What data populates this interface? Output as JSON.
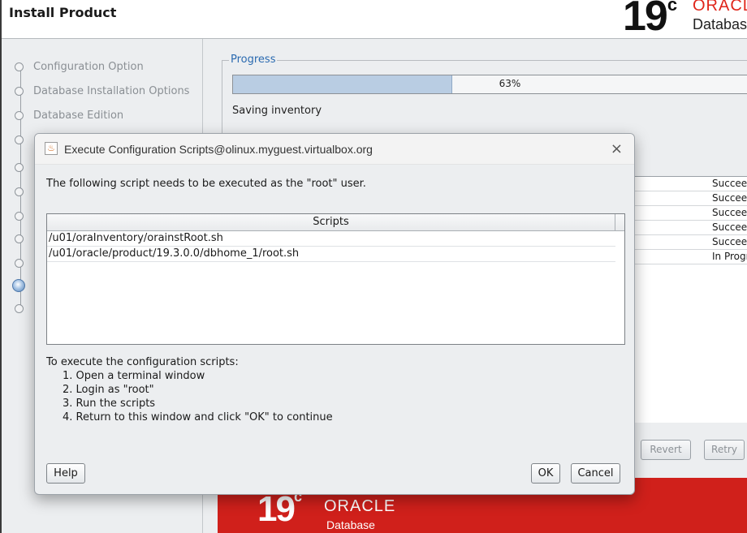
{
  "installer": {
    "title": "Install Product",
    "logo": {
      "version": "19",
      "suffix": "c",
      "brand": "ORACLE",
      "product": "Database"
    },
    "steps": [
      {
        "label": "Configuration Option"
      },
      {
        "label": "Database Installation Options"
      },
      {
        "label": "Database Edition"
      }
    ],
    "progress": {
      "legend": "Progress",
      "percent_label": "63%",
      "percent_value": 63,
      "status": "Saving inventory"
    },
    "status_column": [
      "Succeeded",
      "Succeeded",
      "Succeeded",
      "Succeeded",
      "Succeeded",
      "In Progress"
    ],
    "buttons": {
      "revert": "Revert",
      "retry": "Retry"
    },
    "banner": {
      "version": "19",
      "suffix": "c",
      "brand": "ORACLE",
      "product": "Database"
    }
  },
  "dialog": {
    "title": "Execute Configuration Scripts@olinux.myguest.virtualbox.org",
    "message": "The following script needs to be executed as the \"root\" user.",
    "table": {
      "header": "Scripts",
      "rows": [
        "/u01/oraInventory/orainstRoot.sh",
        "/u01/oracle/product/19.3.0.0/dbhome_1/root.sh"
      ]
    },
    "instructions": {
      "intro": "To execute the configuration scripts:",
      "steps": [
        "1. Open a terminal window",
        "2. Login as \"root\"",
        "3. Run the scripts",
        "4. Return to this window and click \"OK\" to continue"
      ]
    },
    "buttons": {
      "help": "Help",
      "ok": "OK",
      "cancel": "Cancel"
    },
    "close_glyph": "×"
  },
  "colors": {
    "accent": "#2a6ab0",
    "oracle_red": "#d0201b",
    "progress_fill": "#b9cde3"
  }
}
